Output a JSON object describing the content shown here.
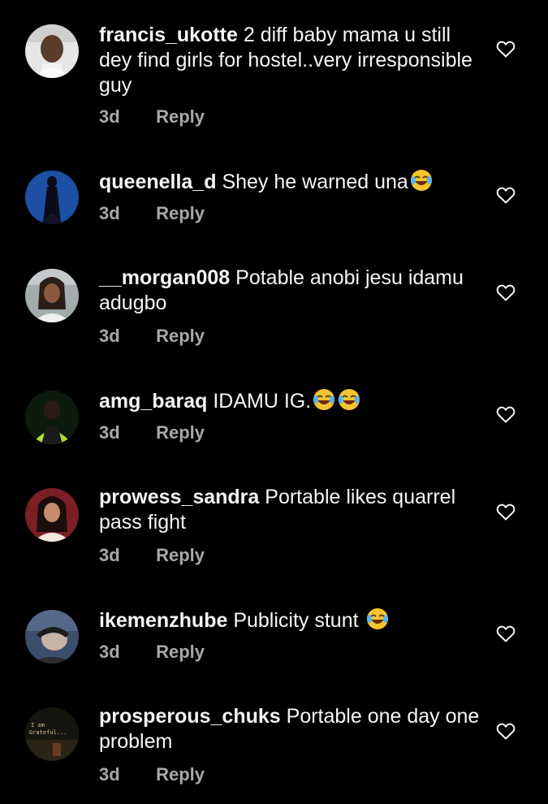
{
  "comments": [
    {
      "username": "francis_ukotte",
      "text": "2 diff baby mama u still dey find girls for hostel..very irresponsible guy",
      "time": "3d",
      "reply": "Reply",
      "emoji_count": 0
    },
    {
      "username": "queenella_d",
      "text": "Shey he warned una",
      "time": "3d",
      "reply": "Reply",
      "emoji_count": 1
    },
    {
      "username": "__morgan008",
      "text": "Potable anobi jesu idamu adugbo",
      "time": "3d",
      "reply": "Reply",
      "emoji_count": 0
    },
    {
      "username": "amg_baraq",
      "text": "IDAMU IG.",
      "time": "3d",
      "reply": "Reply",
      "emoji_count": 2
    },
    {
      "username": "prowess_sandra",
      "text": "Portable likes quarrel pass fight",
      "time": "3d",
      "reply": "Reply",
      "emoji_count": 0
    },
    {
      "username": "ikemenzhube",
      "text": "Publicity stunt",
      "time": "3d",
      "reply": "Reply",
      "emoji_count": 1
    },
    {
      "username": "prosperous_chuks",
      "text": "Portable one day one problem",
      "time": "3d",
      "reply": "Reply",
      "emoji_count": 0
    }
  ],
  "avatar_images": [
    {
      "icon": "user-avatar-photo",
      "colors": [
        "#d9d9d9",
        "#5a3a2a"
      ]
    },
    {
      "icon": "user-avatar-photo",
      "colors": [
        "#1c4fa3",
        "#0b0b1a"
      ]
    },
    {
      "icon": "user-avatar-photo",
      "colors": [
        "#9aa3a6",
        "#3a2a22"
      ]
    },
    {
      "icon": "user-avatar-photo",
      "colors": [
        "#0d1a0d",
        "#b8e03a"
      ]
    },
    {
      "icon": "user-avatar-photo",
      "colors": [
        "#7a1d22",
        "#f2e6e0"
      ]
    },
    {
      "icon": "user-avatar-photo",
      "colors": [
        "#3a4d6b",
        "#c9b6a8"
      ]
    },
    {
      "icon": "user-avatar-photo",
      "colors": [
        "#1b1b12",
        "#c9a24a"
      ]
    }
  ],
  "avatar_logo_text": [
    "I am",
    "Grateful..."
  ],
  "icons": {
    "like": "heart-outline-icon",
    "emoji": "face-with-tears-of-joy-icon"
  },
  "colors": {
    "background": "#000000",
    "text": "#f5f5f5",
    "meta": "#a8a8a8"
  }
}
